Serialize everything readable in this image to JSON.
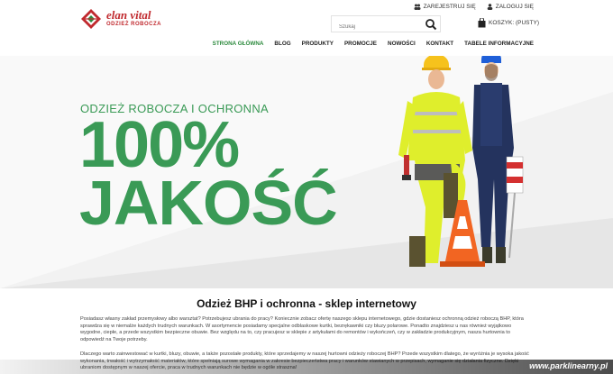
{
  "brand": {
    "name": "elan vital",
    "tagline": "ODZIEŻ ROBOCZA",
    "colors": {
      "primary_red": "#c0292e",
      "green": "#3a9a56",
      "nav_active": "#2c8a3d"
    }
  },
  "top_links": [
    {
      "label": "ZAREJESTRUJ SIĘ",
      "icon": "users-icon"
    },
    {
      "label": "ZALOGUJ SIĘ",
      "icon": "user-icon"
    }
  ],
  "search": {
    "placeholder": "Szukaj",
    "icon": "search-icon"
  },
  "cart": {
    "label": "KOSZYK: (PUSTY)",
    "icon": "cart-icon"
  },
  "nav": [
    {
      "label": "STRONA GŁÓWNA",
      "active": true
    },
    {
      "label": "BLOG"
    },
    {
      "label": "PRODUKTY"
    },
    {
      "label": "PROMOCJE"
    },
    {
      "label": "NOWOŚCI"
    },
    {
      "label": "KONTAKT"
    },
    {
      "label": "TABELE INFORMACYJNE"
    }
  ],
  "hero": {
    "subtitle": "ODZIEŻ ROBOCZA I OCHRONNA",
    "line1": "100%",
    "line2": "JAKOŚĆ"
  },
  "content": {
    "title": "Odzież BHP i ochronna - sklep internetowy",
    "paragraph1": "Posiadasz własny zakład przemysłowy albo warsztat? Potrzebujesz ubrania do pracy? Koniecznie zobacz ofertę naszego sklepu internetowego, gdzie dostaniesz ochronną odzież roboczą BHP, która sprawdza się w niemalże każdych trudnych warunkach. W asortymencie posiadamy specjalne odblaskowe kurtki, bezrękawniki czy bluzy polarowe. Ponadto znajdziesz u nas również wyjątkowo wygodne, ciepłe, a przede wszystkim bezpieczne obuwie. Bez względu na to, czy pracujesz w sklepie z artykułami do remontów i wykończeń, czy w zakładzie produkcyjnym, nasza hurtownia to odpowiedź na Twoje potrzeby.",
    "paragraph2": "Dlaczego warto zainwestować w kurtki, bluzy, obuwie, a także pozostałe produkty, które sprzedajemy w naszej hurtowni odzieży roboczej BHP? Przede wszystkim dlatego, że wyróżnia je wysoka jakość wykonania, trwałość i wytrzymałość materiałów, które spełniają surowe wymagania w zakresie bezpieczeństwa pracy i warunków stawianych w przepisach, wymaganie się działania fizyczne. Dzięki ubraniom dostępnym w naszej ofercie, praca w trudnych warunkach nie będzie w ogóle straszna!"
  },
  "watermark": "www.parklinearny.pl"
}
